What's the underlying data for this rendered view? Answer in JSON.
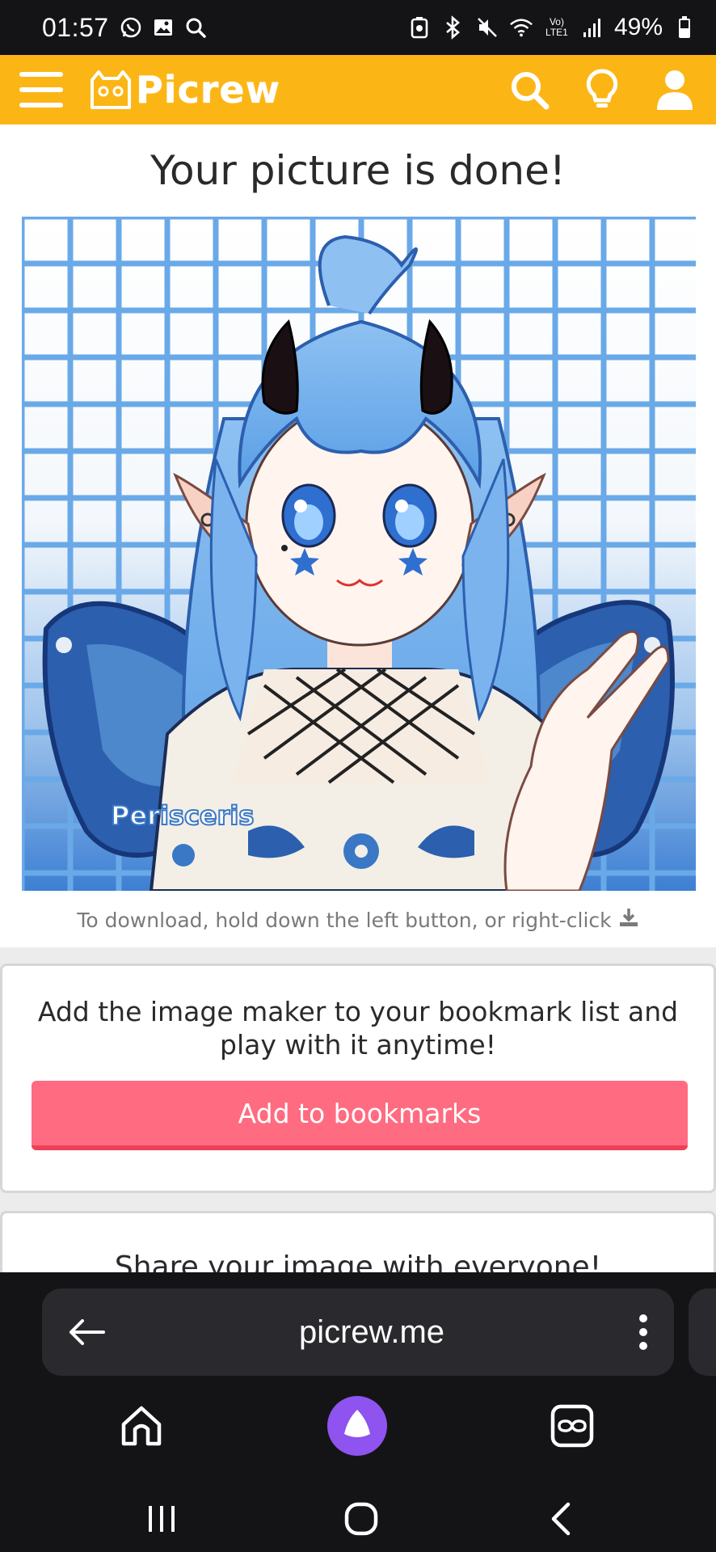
{
  "status_bar": {
    "time": "01:57",
    "battery": "49%",
    "network_label": "Vo) LTE1",
    "left_icons": [
      "whatsapp-icon",
      "gallery-icon",
      "search-icon"
    ],
    "right_icons": [
      "battery-saver-icon",
      "bluetooth-icon",
      "mute-icon",
      "wifi-icon",
      "volte-icon",
      "signal-icon",
      "battery-icon"
    ]
  },
  "header": {
    "logo_text": "Picrew",
    "icons": [
      "menu-icon",
      "search-icon",
      "lightbulb-icon",
      "user-icon"
    ],
    "accent_color": "#fbb616"
  },
  "main": {
    "title": "Your picture is done!",
    "picture": {
      "watermark": "Perisceris",
      "description_icon": "generated-avatar-image"
    },
    "download_hint": "To download, hold down the left button, or right-click"
  },
  "bookmark_card": {
    "text": "Add the image maker to your bookmark list and play with it anytime!",
    "button_label": "Add to bookmarks",
    "button_color": "#ff6b80"
  },
  "share_card": {
    "text": "Share your image with everyone!"
  },
  "browser": {
    "url": "picrew.me",
    "icons": [
      "back-arrow-icon",
      "more-vertical-icon",
      "home-icon",
      "assistant-icon",
      "tabs-icon"
    ]
  },
  "system_nav": {
    "icons": [
      "recents-icon",
      "home-circle-icon",
      "back-chevron-icon"
    ]
  }
}
